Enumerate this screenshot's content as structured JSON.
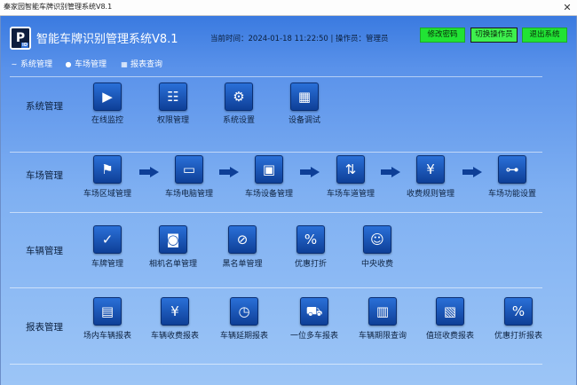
{
  "window": {
    "title": "秦家园智能车牌识别管理系统V8.1",
    "close_glyph": "✕"
  },
  "header": {
    "logo_letter": "P",
    "logo_sub": "ID",
    "app_title": "智能车牌识别管理系统V8.1",
    "clock": "当前时间：2024-01-18 11:22:50 | 操作员：管理员",
    "buttons": [
      "修改密码",
      "切换操作员",
      "退出系统"
    ]
  },
  "nav": [
    {
      "label": "系统管理",
      "icon": "share-icon"
    },
    {
      "label": "车场管理",
      "icon": "users-icon"
    },
    {
      "label": "报表查询",
      "icon": "chart-icon"
    }
  ],
  "sections": [
    {
      "label": "系统管理",
      "tiles": [
        {
          "label": "在线监控",
          "icon": "camera-icon",
          "glyph": "▶"
        },
        {
          "label": "权限管理",
          "icon": "hierarchy-icon",
          "glyph": "☷"
        },
        {
          "label": "系统设置",
          "icon": "gear-icon",
          "glyph": "⚙"
        },
        {
          "label": "设备调试",
          "icon": "device-icon",
          "glyph": "▦"
        }
      ]
    },
    {
      "label": "车场管理",
      "tiles": [
        {
          "label": "车场区域管理",
          "icon": "flag-icon",
          "glyph": "⚑"
        },
        {
          "label": "车场电脑管理",
          "icon": "monitor-icon",
          "glyph": "▭"
        },
        {
          "label": "车场设备管理",
          "icon": "window-icon",
          "glyph": "▣"
        },
        {
          "label": "车场车道管理",
          "icon": "lane-icon",
          "glyph": "⇅"
        },
        {
          "label": "收费规则管理",
          "icon": "fee-rule-icon",
          "glyph": "¥"
        },
        {
          "label": "车场功能设置",
          "icon": "toggle-icon",
          "glyph": "⊶"
        }
      ]
    },
    {
      "label": "车辆管理",
      "tiles": [
        {
          "label": "车牌管理",
          "icon": "shield-check-icon",
          "glyph": "✓"
        },
        {
          "label": "相机名单管理",
          "icon": "camera-list-icon",
          "glyph": "◙"
        },
        {
          "label": "黑名单管理",
          "icon": "blacklist-icon",
          "glyph": "⊘"
        },
        {
          "label": "优惠打折",
          "icon": "discount-icon",
          "glyph": "%"
        },
        {
          "label": "中央收费",
          "icon": "cashier-icon",
          "glyph": "☺"
        }
      ]
    },
    {
      "label": "报表管理",
      "tiles": [
        {
          "label": "场内车辆报表",
          "icon": "parking-report-icon",
          "glyph": "▤"
        },
        {
          "label": "车辆收费报表",
          "icon": "fee-report-icon",
          "glyph": "¥"
        },
        {
          "label": "车辆延期报表",
          "icon": "extension-report-icon",
          "glyph": "◷"
        },
        {
          "label": "一位多车报表",
          "icon": "multi-car-icon",
          "glyph": "⛟"
        },
        {
          "label": "车辆期限查询",
          "icon": "term-query-icon",
          "glyph": "▥"
        },
        {
          "label": "值班收费报表",
          "icon": "duty-report-icon",
          "glyph": "▧"
        },
        {
          "label": "优惠打折报表",
          "icon": "discount-report-icon",
          "glyph": "%"
        }
      ]
    }
  ]
}
